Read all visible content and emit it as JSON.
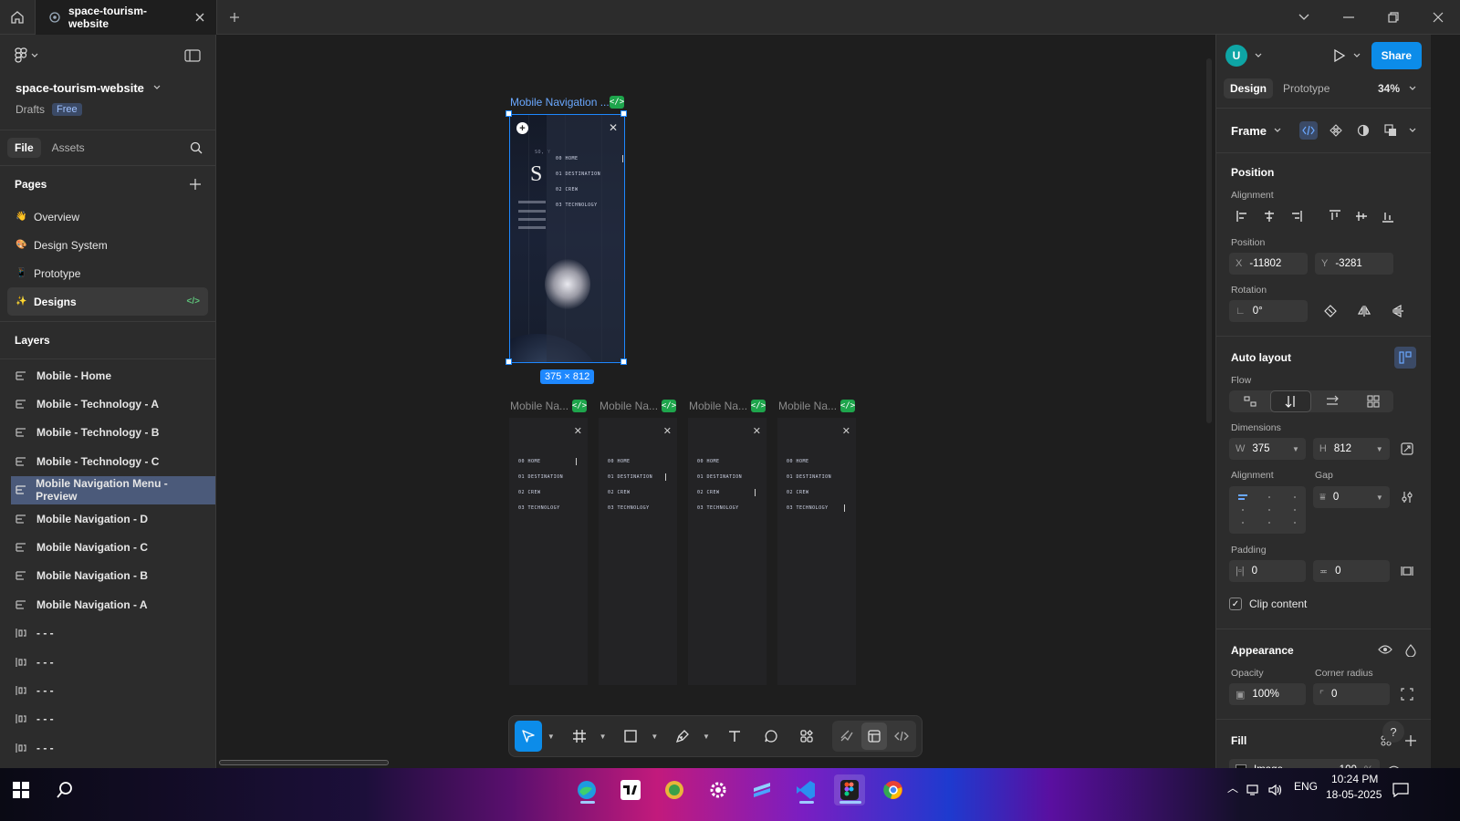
{
  "titlebar": {
    "tab_title": "space-tourism-website"
  },
  "left": {
    "project_name": "space-tourism-website",
    "drafts_label": "Drafts",
    "plan_badge": "Free",
    "tab_file": "File",
    "tab_assets": "Assets",
    "pages_header": "Pages",
    "pages": [
      {
        "emoji": "👋",
        "label": "Overview"
      },
      {
        "emoji": "🎨",
        "label": "Design System"
      },
      {
        "emoji": "📱",
        "label": "Prototype"
      },
      {
        "emoji": "✨",
        "label": "Designs"
      }
    ],
    "layers_header": "Layers",
    "layers": [
      "Mobile - Home",
      "Mobile - Technology - A",
      "Mobile - Technology - B",
      "Mobile - Technology - C",
      "Mobile Navigation Menu - Preview",
      "Mobile Navigation - D",
      "Mobile Navigation - C",
      "Mobile Navigation - B",
      "Mobile Navigation - A",
      "- - -",
      "- - -",
      "- - -",
      "- - -",
      "- - -",
      "- - -"
    ]
  },
  "canvas": {
    "main_frame_label": "Mobile Navigation ...",
    "dimensions": "375 × 812",
    "small_frame_labels": [
      "Mobile Na...",
      "Mobile Na...",
      "Mobile Na...",
      "Mobile Na..."
    ],
    "nav_items": [
      "00 HOME",
      "01 DESTINATION",
      "02 CREW",
      "03 TECHNOLOGY"
    ],
    "main_frame_heading": "S",
    "main_frame_kicker": "SO, Y"
  },
  "right": {
    "avatar_letter": "U",
    "share_label": "Share",
    "tab_design": "Design",
    "tab_prototype": "Prototype",
    "zoom": "34%",
    "frame_label": "Frame",
    "position_header": "Position",
    "alignment_label": "Alignment",
    "position_label": "Position",
    "x_label": "X",
    "x_value": "-11802",
    "y_label": "Y",
    "y_value": "-3281",
    "rotation_label": "Rotation",
    "rotation_value": "0°",
    "auto_layout_header": "Auto layout",
    "flow_label": "Flow",
    "dimensions_label": "Dimensions",
    "w_label": "W",
    "w_value": "375",
    "h_label": "H",
    "h_value": "812",
    "al_alignment_label": "Alignment",
    "gap_label": "Gap",
    "gap_value": "0",
    "padding_label": "Padding",
    "padding_h": "0",
    "padding_v": "0",
    "clip_content_label": "Clip content",
    "appearance_header": "Appearance",
    "opacity_label": "Opacity",
    "opacity_value": "100%",
    "corner_radius_label": "Corner radius",
    "corner_radius_value": "0",
    "fill_header": "Fill",
    "fill_type": "Image",
    "fill_opacity": "100",
    "fill_pct": "%"
  },
  "taskbar": {
    "lang": "ENG",
    "time": "10:24 PM",
    "date": "18-05-2025"
  },
  "colors": {
    "accent": "#0c8ce9",
    "selection": "#1e88ff",
    "code_badge": "#1ea54c"
  }
}
